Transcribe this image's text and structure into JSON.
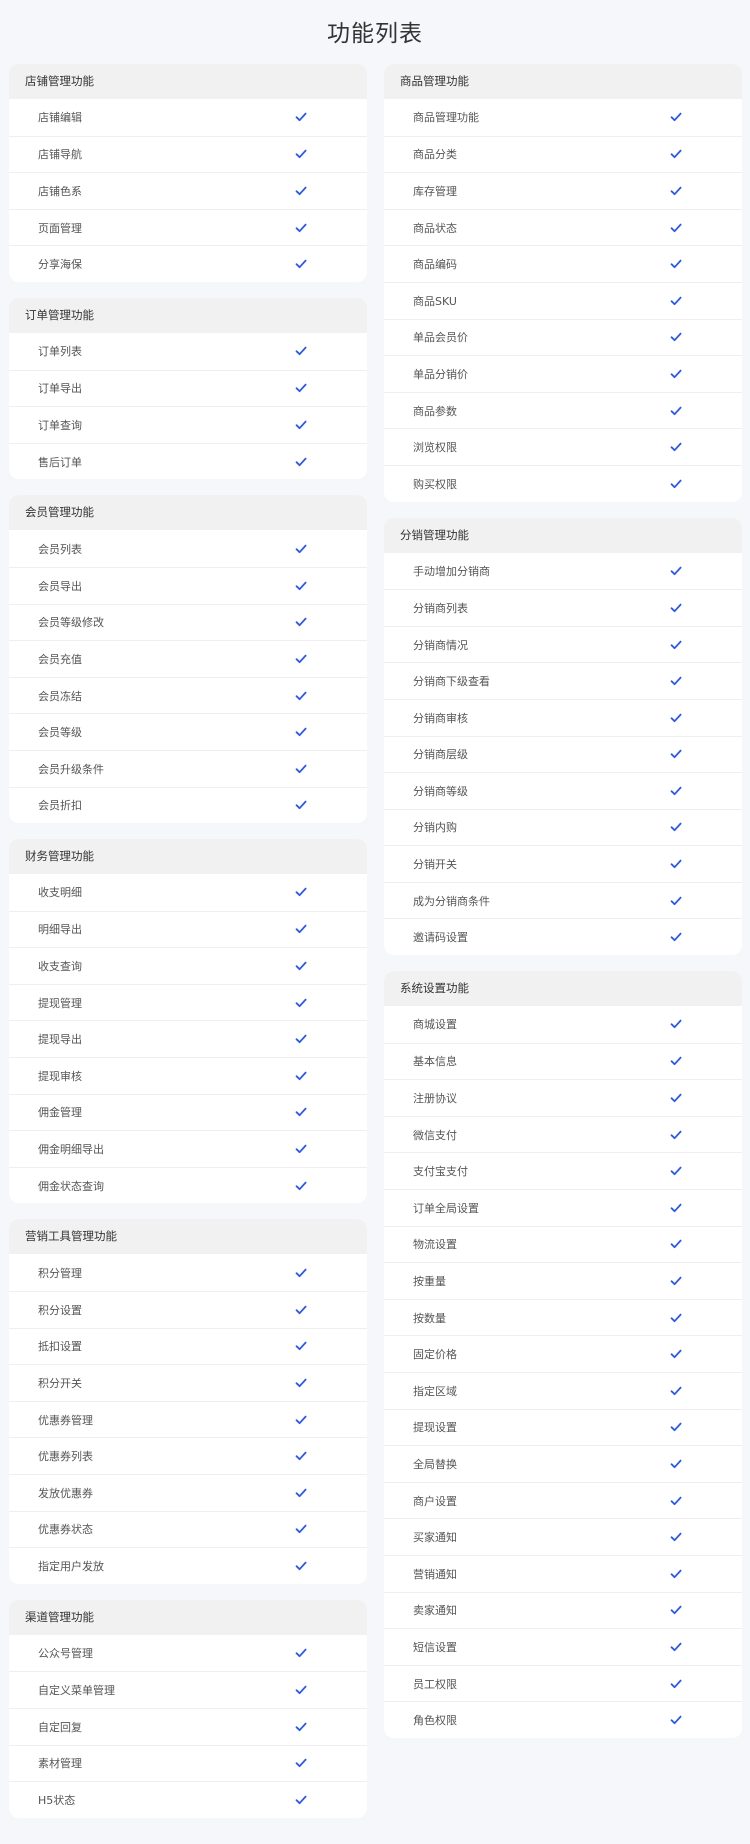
{
  "page_title": "功能列表",
  "icons": {
    "check": "check-icon"
  },
  "colors": {
    "accent": "#2f5bd8",
    "background": "#f6f7fa",
    "header_bg": "#f1f1f2"
  },
  "columns": [
    {
      "sections": [
        {
          "title": "店铺管理功能",
          "items": [
            "店铺编辑",
            "店铺导航",
            "店铺色系",
            "页面管理",
            "分享海保"
          ]
        },
        {
          "title": "订单管理功能",
          "items": [
            "订单列表",
            "订单导出",
            "订单查询",
            "售后订单"
          ]
        },
        {
          "title": "会员管理功能",
          "items": [
            "会员列表",
            "会员导出",
            "会员等级修改",
            "会员充值",
            "会员冻结",
            "会员等级",
            "会员升级条件",
            "会员折扣"
          ]
        },
        {
          "title": "财务管理功能",
          "items": [
            "收支明细",
            "明细导出",
            "收支查询",
            "提现管理",
            "提现导出",
            "提现审核",
            "佣金管理",
            "佣金明细导出",
            "佣金状态查询"
          ]
        },
        {
          "title": "营销工具管理功能",
          "items": [
            "积分管理",
            "积分设置",
            "抵扣设置",
            "积分开关",
            "优惠券管理",
            "优惠券列表",
            "发放优惠券",
            "优惠券状态",
            "指定用户发放"
          ]
        },
        {
          "title": "渠道管理功能",
          "items": [
            "公众号管理",
            "自定义菜单管理",
            "自定回复",
            "素材管理",
            "H5状态"
          ]
        }
      ]
    },
    {
      "sections": [
        {
          "title": "商品管理功能",
          "items": [
            "商品管理功能",
            "商品分类",
            "库存管理",
            "商品状态",
            "商品编码",
            "商品SKU",
            "单品会员价",
            "单品分销价",
            "商品参数",
            "浏览权限",
            "购买权限"
          ]
        },
        {
          "title": "分销管理功能",
          "items": [
            "手动增加分销商",
            "分销商列表",
            "分销商情况",
            "分销商下级查看",
            "分销商审核",
            "分销商层级",
            "分销商等级",
            "分销内购",
            "分销开关",
            "成为分销商条件",
            "邀请码设置"
          ]
        },
        {
          "title": "系统设置功能",
          "items": [
            "商城设置",
            "基本信息",
            "注册协议",
            "微信支付",
            "支付宝支付",
            "订单全局设置",
            "物流设置",
            "按重量",
            "按数量",
            "固定价格",
            "指定区域",
            "提现设置",
            "全局替换",
            "商户设置",
            "买家通知",
            "营销通知",
            "卖家通知",
            "短信设置",
            "员工权限",
            "角色权限"
          ]
        }
      ]
    }
  ]
}
